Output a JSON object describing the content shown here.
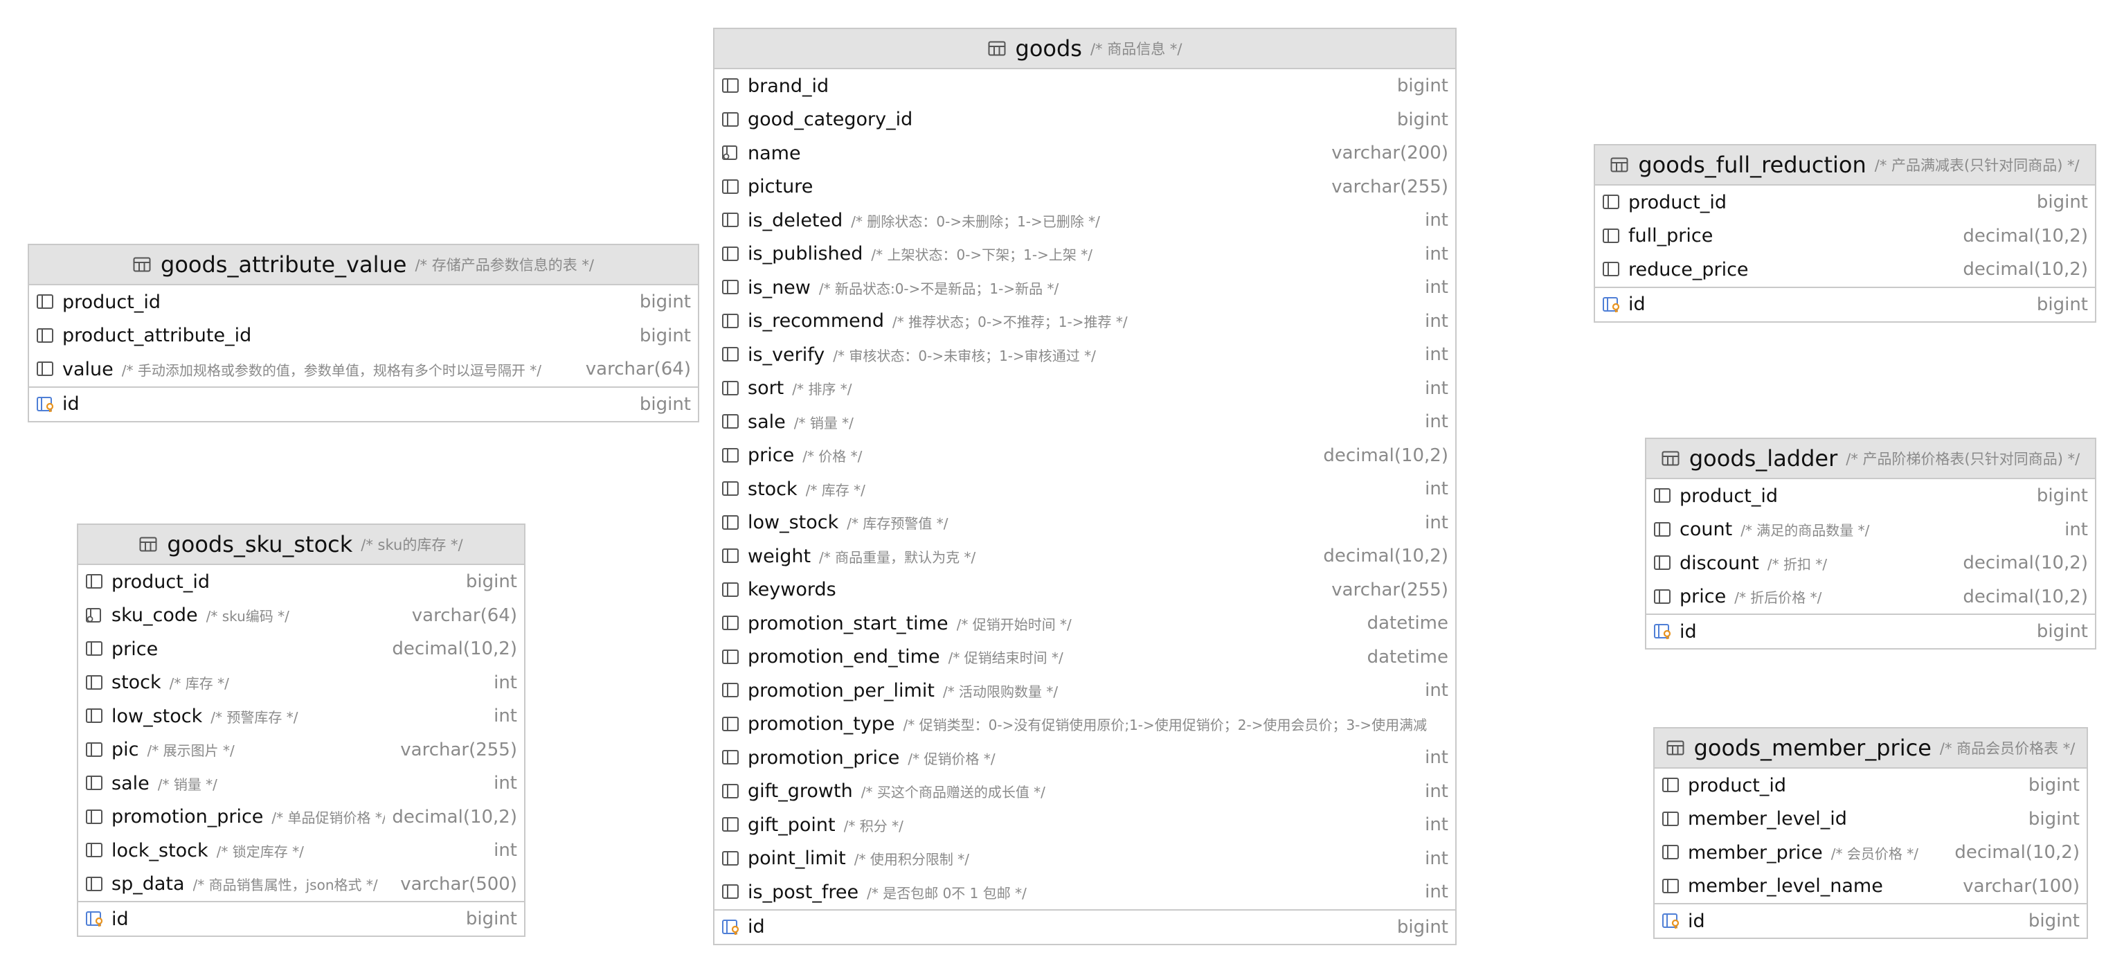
{
  "tables": {
    "goods": {
      "name": "goods",
      "comment": "/* 商品信息 */",
      "columns": [
        {
          "name": "brand_id",
          "comment": "",
          "type": "bigint"
        },
        {
          "name": "good_category_id",
          "comment": "",
          "type": "bigint"
        },
        {
          "name": "name",
          "comment": "",
          "type": "varchar(200)",
          "icon": "key-column-icon"
        },
        {
          "name": "picture",
          "comment": "",
          "type": "varchar(255)"
        },
        {
          "name": "is_deleted",
          "comment": "/* 删除状态：0->未删除；1->已删除 */",
          "type": "int"
        },
        {
          "name": "is_published",
          "comment": "/* 上架状态：0->下架；1->上架 */",
          "type": "int"
        },
        {
          "name": "is_new",
          "comment": "/* 新品状态:0->不是新品；1->新品 */",
          "type": "int"
        },
        {
          "name": "is_recommend",
          "comment": "/* 推荐状态；0->不推荐；1->推荐 */",
          "type": "int"
        },
        {
          "name": "is_verify",
          "comment": "/* 审核状态：0->未审核；1->审核通过 */",
          "type": "int"
        },
        {
          "name": "sort",
          "comment": "/* 排序 */",
          "type": "int"
        },
        {
          "name": "sale",
          "comment": "/* 销量 */",
          "type": "int"
        },
        {
          "name": "price",
          "comment": "/* 价格 */",
          "type": "decimal(10,2)"
        },
        {
          "name": "stock",
          "comment": "/* 库存 */",
          "type": "int"
        },
        {
          "name": "low_stock",
          "comment": "/* 库存预警值 */",
          "type": "int"
        },
        {
          "name": "weight",
          "comment": "/* 商品重量，默认为克 */",
          "type": "decimal(10,2)"
        },
        {
          "name": "keywords",
          "comment": "",
          "type": "varchar(255)"
        },
        {
          "name": "promotion_start_time",
          "comment": "/* 促销开始时间 */",
          "type": "datetime"
        },
        {
          "name": "promotion_end_time",
          "comment": "/* 促销结束时间 */",
          "type": "datetime"
        },
        {
          "name": "promotion_per_limit",
          "comment": "/* 活动限购数量 */",
          "type": "int"
        },
        {
          "name": "promotion_type",
          "comment": "/* 促销类型：0->没有促销使用原价;1->使用促销价；2->使用会员价；3->使用满减",
          "type": ""
        },
        {
          "name": "promotion_price",
          "comment": "/* 促销价格 */",
          "type": "int"
        },
        {
          "name": "gift_growth",
          "comment": "/* 买这个商品赠送的成长值 */",
          "type": "int"
        },
        {
          "name": "gift_point",
          "comment": "/* 积分 */",
          "type": "int"
        },
        {
          "name": "point_limit",
          "comment": "/* 使用积分限制 */",
          "type": "int"
        },
        {
          "name": "is_post_free",
          "comment": "/* 是否包邮 0不 1 包邮 */",
          "type": "int"
        }
      ],
      "pk": {
        "name": "id",
        "type": "bigint"
      }
    },
    "goods_attribute_value": {
      "name": "goods_attribute_value",
      "comment": "/* 存储产品参数信息的表 */",
      "columns": [
        {
          "name": "product_id",
          "comment": "",
          "type": "bigint"
        },
        {
          "name": "product_attribute_id",
          "comment": "",
          "type": "bigint"
        },
        {
          "name": "value",
          "comment": "/* 手动添加规格或参数的值，参数单值，规格有多个时以逗号隔开 */",
          "type": "varchar(64)"
        }
      ],
      "pk": {
        "name": "id",
        "type": "bigint"
      }
    },
    "goods_sku_stock": {
      "name": "goods_sku_stock",
      "comment": "/* sku的库存 */",
      "columns": [
        {
          "name": "product_id",
          "comment": "",
          "type": "bigint"
        },
        {
          "name": "sku_code",
          "comment": "/* sku编码 */",
          "type": "varchar(64)",
          "icon": "key-column-icon"
        },
        {
          "name": "price",
          "comment": "",
          "type": "decimal(10,2)"
        },
        {
          "name": "stock",
          "comment": "/* 库存 */",
          "type": "int"
        },
        {
          "name": "low_stock",
          "comment": "/* 预警库存 */",
          "type": "int"
        },
        {
          "name": "pic",
          "comment": "/* 展示图片 */",
          "type": "varchar(255)"
        },
        {
          "name": "sale",
          "comment": "/* 销量 */",
          "type": "int"
        },
        {
          "name": "promotion_price",
          "comment": "/* 单品促销价格 */",
          "type": "decimal(10,2)"
        },
        {
          "name": "lock_stock",
          "comment": "/* 锁定库存 */",
          "type": "int"
        },
        {
          "name": "sp_data",
          "comment": "/* 商品销售属性，json格式 */",
          "type": "varchar(500)"
        }
      ],
      "pk": {
        "name": "id",
        "type": "bigint"
      }
    },
    "goods_full_reduction": {
      "name": "goods_full_reduction",
      "comment": "/* 产品满减表(只针对同商品) */",
      "columns": [
        {
          "name": "product_id",
          "comment": "",
          "type": "bigint"
        },
        {
          "name": "full_price",
          "comment": "",
          "type": "decimal(10,2)"
        },
        {
          "name": "reduce_price",
          "comment": "",
          "type": "decimal(10,2)"
        }
      ],
      "pk": {
        "name": "id",
        "type": "bigint"
      }
    },
    "goods_ladder": {
      "name": "goods_ladder",
      "comment": "/* 产品阶梯价格表(只针对同商品) */",
      "columns": [
        {
          "name": "product_id",
          "comment": "",
          "type": "bigint"
        },
        {
          "name": "count",
          "comment": "/* 满足的商品数量 */",
          "type": "int"
        },
        {
          "name": "discount",
          "comment": "/* 折扣 */",
          "type": "decimal(10,2)"
        },
        {
          "name": "price",
          "comment": "/* 折后价格 */",
          "type": "decimal(10,2)"
        }
      ],
      "pk": {
        "name": "id",
        "type": "bigint"
      }
    },
    "goods_member_price": {
      "name": "goods_member_price",
      "comment": "/* 商品会员价格表 */",
      "columns": [
        {
          "name": "product_id",
          "comment": "",
          "type": "bigint"
        },
        {
          "name": "member_level_id",
          "comment": "",
          "type": "bigint"
        },
        {
          "name": "member_price",
          "comment": "/* 会员价格 */",
          "type": "decimal(10,2)"
        },
        {
          "name": "member_level_name",
          "comment": "",
          "type": "varchar(100)"
        }
      ],
      "pk": {
        "name": "id",
        "type": "bigint"
      }
    }
  },
  "colors": {
    "header_bg": "#e3e3e3",
    "border": "#c9c9c9",
    "pk_key_accent": "#e8931e",
    "pk_icon_blue": "#4f7fd6",
    "muted_text": "#8a8a8a"
  }
}
